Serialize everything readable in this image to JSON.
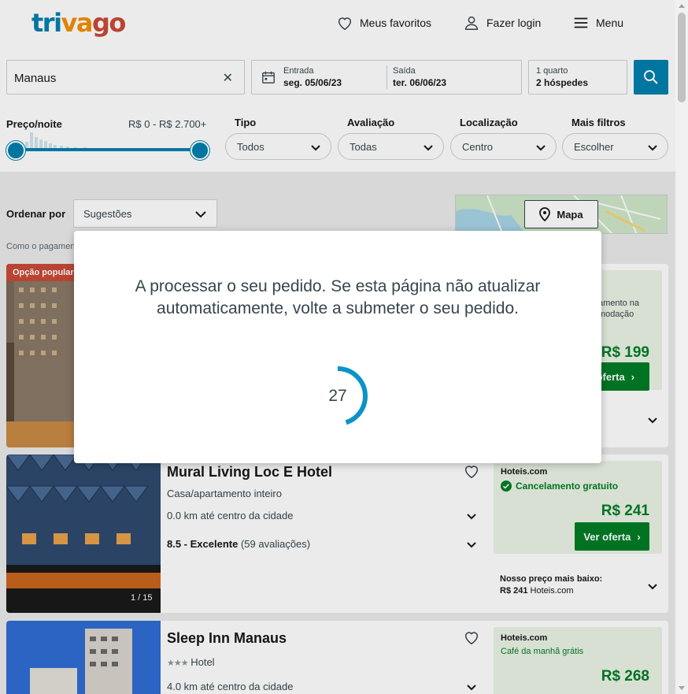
{
  "header": {
    "logo": {
      "part1": "tri",
      "part2": "va",
      "part3": "go"
    },
    "favorites": "Meus favoritos",
    "login": "Fazer login",
    "menu": "Menu"
  },
  "search": {
    "destination": "Manaus",
    "checkin_label": "Entrada",
    "checkin_value": "seg. 05/06/23",
    "checkout_label": "Saída",
    "checkout_value": "ter. 06/06/23",
    "rooms": "1 quarto",
    "guests": "2 hóspedes"
  },
  "filters": {
    "price_label": "Preço/noite",
    "price_range": "R$ 0 - R$ 2.700+",
    "type_title": "Tipo",
    "type_value": "Todos",
    "rating_title": "Avaliação",
    "rating_value": "Todas",
    "location_title": "Localização",
    "location_value": "Centro",
    "more_title": "Mais filtros",
    "more_value": "Escolher"
  },
  "sort": {
    "label": "Ordenar por",
    "value": "Sugestões",
    "map_button": "Mapa",
    "how_we_are_paid": "Como o pagamento"
  },
  "results": [
    {
      "badge": "Opção popular",
      "offer": {
        "perk_line1": "amento na",
        "perk_line2": "modação",
        "price": "R$ 199",
        "cta": "r oferta"
      }
    },
    {
      "name": "Mural Living Loc E Hotel",
      "type": "Casa/apartamento inteiro",
      "distance": "0.0 km até centro da cidade",
      "rating": "8.5 - Excelente",
      "reviews": "(59 avaliações)",
      "image_counter": "1 / 15",
      "offer": {
        "site": "Hoteis.com",
        "perk": "Cancelamento gratuito",
        "price": "R$ 241",
        "cta": "Ver oferta"
      },
      "lowest_label": "Nosso preço mais baixo:",
      "lowest_price": "R$ 241",
      "lowest_site": "Hoteis.com"
    },
    {
      "name": "Sleep Inn Manaus",
      "stars": "★★★",
      "type": "Hotel",
      "distance": "4.0 km até centro da cidade",
      "offer": {
        "site": "Hoteis.com",
        "perk": "Café da manhã grátis",
        "price": "R$ 268"
      }
    }
  ],
  "modal": {
    "message": "A processar o seu pedido. Se esta página não atualizar automaticamente, volte a submeter o seu pedido.",
    "countdown": "27",
    "progress": 0.45
  },
  "colors": {
    "brand_blue": "#007fad",
    "brand_orange": "#f48f00",
    "brand_red": "#c94a38",
    "offer_green": "#007d27"
  }
}
